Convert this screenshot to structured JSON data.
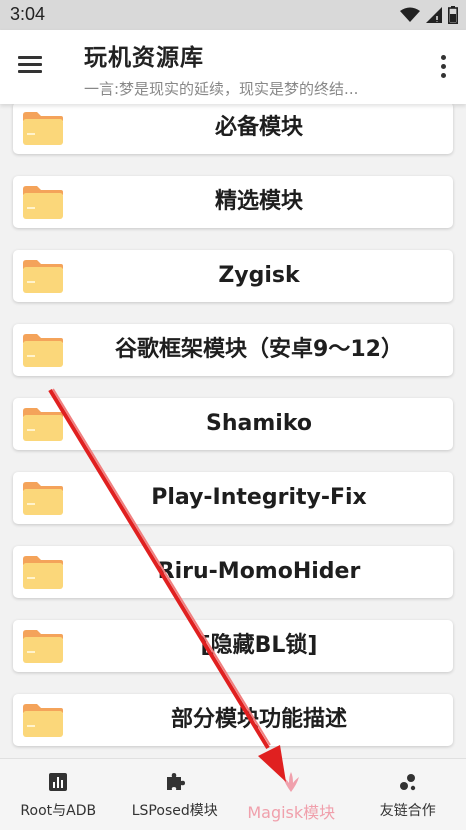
{
  "status": {
    "time": "3:04"
  },
  "app_bar": {
    "title": "玩机资源库",
    "subtitle": "一言:梦是现实的延续，现实是梦的终结..."
  },
  "items": [
    {
      "label": "必备模块"
    },
    {
      "label": "精选模块"
    },
    {
      "label": "Zygisk"
    },
    {
      "label": "谷歌框架模块（安卓9～12）"
    },
    {
      "label": "Shamiko"
    },
    {
      "label": "Play-Integrity-Fix"
    },
    {
      "label": "Riru-MomoHider"
    },
    {
      "label": "[隐藏BL锁]"
    },
    {
      "label": "部分模块功能描述"
    }
  ],
  "bottom_nav": {
    "items": [
      {
        "label": "Root与ADB",
        "icon": "bar-chart-icon"
      },
      {
        "label": "LSPosed模块",
        "icon": "puzzle-icon"
      },
      {
        "label": "Magisk模块",
        "icon": "magisk-icon",
        "active": true
      },
      {
        "label": "友链合作",
        "icon": "bubbles-icon"
      }
    ]
  },
  "colors": {
    "accent": "#f0a0ac",
    "folder": "#fbd77a",
    "folder_tab": "#f4a35a",
    "annotation_arrow": "#e02020"
  }
}
